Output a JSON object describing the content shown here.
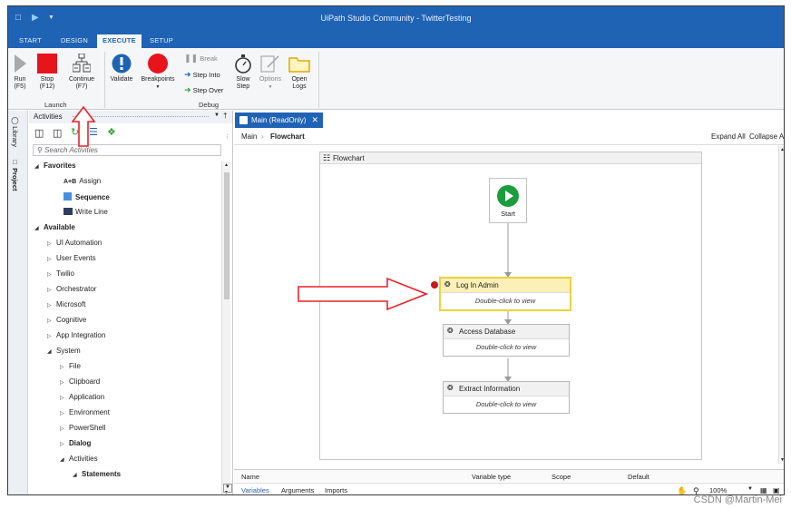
{
  "window": {
    "title": "UiPath Studio Community - TwitterTesting"
  },
  "ribbon_tabs": [
    {
      "label": "START",
      "active": false
    },
    {
      "label": "DESIGN",
      "active": false
    },
    {
      "label": "EXECUTE",
      "active": true
    },
    {
      "label": "SETUP",
      "active": false
    }
  ],
  "ribbon": {
    "run": {
      "line1": "Run",
      "line2": "(F5)"
    },
    "stop": {
      "line1": "Stop",
      "line2": "(F12)"
    },
    "continue": {
      "line1": "Continue",
      "line2": "(F7)"
    },
    "launch_group": "Launch",
    "validate": "Validate",
    "breakpoints": "Breakpoints",
    "break": "Break",
    "step_into": "Step Into",
    "step_over": "Step Over",
    "slow_step": {
      "line1": "Slow",
      "line2": "Step"
    },
    "options": "Options",
    "open_logs": {
      "line1": "Open",
      "line2": "Logs"
    },
    "debug_group": "Debug",
    "colors": {
      "stop": "#e8141b",
      "breakpoints": "#e8141b",
      "run": "#a9a9a9",
      "step_green": "#2d9e36",
      "step_blue": "#1f63b5"
    }
  },
  "rail": {
    "library": "Library",
    "project": "Project"
  },
  "activities": {
    "title": "Activities",
    "search_placeholder": "Search Activities",
    "tree": [
      {
        "label": "Favorites",
        "expanded": true,
        "bold": true
      },
      {
        "label": "Assign",
        "icon": "assign-icon"
      },
      {
        "label": "Sequence",
        "icon": "sequence-icon",
        "highlighted": true
      },
      {
        "label": "Write Line",
        "icon": "write-line-icon"
      },
      {
        "label": "Available",
        "expanded": true,
        "bold": true
      },
      {
        "label": "UI Automation"
      },
      {
        "label": "User Events"
      },
      {
        "label": "Twilio"
      },
      {
        "label": "Orchestrator"
      },
      {
        "label": "Microsoft"
      },
      {
        "label": "Cognitive"
      },
      {
        "label": "App Integration"
      },
      {
        "label": "System",
        "expanded": true
      },
      {
        "label": "File"
      },
      {
        "label": "Clipboard"
      },
      {
        "label": "Application"
      },
      {
        "label": "Environment"
      },
      {
        "label": "PowerShell"
      },
      {
        "label": "Dialog",
        "highlighted": true
      },
      {
        "label": "Activities",
        "expanded": true
      },
      {
        "label": "Statements",
        "expanded": true
      }
    ]
  },
  "designer": {
    "doc_tab": "Main (ReadOnly)",
    "breadcrumb": [
      "Main",
      "Flowchart"
    ],
    "expand_all": "Expand All",
    "collapse_all": "Collapse All",
    "flowchart_title": "Flowchart",
    "start_label": "Start",
    "activities": [
      {
        "title": "Log In Admin",
        "body": "Double-click to view",
        "selected": true,
        "breakpoint": true
      },
      {
        "title": "Access Database",
        "body": "Double-click to view",
        "selected": false
      },
      {
        "title": "Extract Information",
        "body": "Double-click to view",
        "selected": false
      }
    ],
    "variables_columns": [
      "Name",
      "Variable type",
      "Scope",
      "Default"
    ],
    "bottom_tabs": [
      "Variables",
      "Arguments",
      "Imports"
    ],
    "zoom": "100%"
  },
  "watermark": "CSDN @Martin-Mei"
}
